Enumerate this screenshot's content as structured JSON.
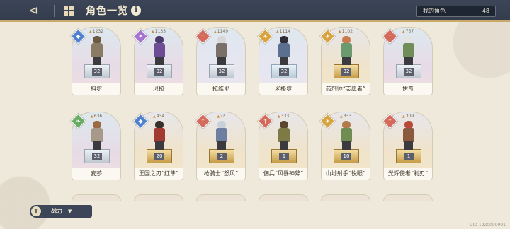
{
  "header": {
    "title": "角色一览",
    "owned_label": "我的角色",
    "owned_count": "48"
  },
  "characters": [
    {
      "name": "科尔",
      "power": "1232",
      "level": "32",
      "class": "blue",
      "class_icon": "shield-icon",
      "bg": "grad-pink",
      "pedestal": "silver",
      "hair": "#6b5a44",
      "outfit": "#8a7c64"
    },
    {
      "name": "贝拉",
      "power": "1135",
      "level": "32",
      "class": "purple",
      "class_icon": "star-icon",
      "bg": "grad-pink",
      "pedestal": "silver",
      "hair": "#4b3a6e",
      "outfit": "#6e4c96"
    },
    {
      "name": "拉维耶",
      "power": "1149",
      "level": "32",
      "class": "red",
      "class_icon": "sword-icon",
      "bg": "grad-blue",
      "pedestal": "silver",
      "hair": "#d6d6d6",
      "outfit": "#7b6f6a"
    },
    {
      "name": "米格尔",
      "power": "1114",
      "level": "32",
      "class": "gold",
      "class_icon": "sun-icon",
      "bg": "grad-blue",
      "pedestal": "lightblue",
      "hair": "#2f2c3a",
      "outfit": "#5b6f8f"
    },
    {
      "name": "药剂师“志愿者”",
      "power": "1102",
      "level": "32",
      "class": "gold",
      "class_icon": "sun-icon",
      "bg": "grad-gold",
      "pedestal": "gold",
      "hair": "#c97b4e",
      "outfit": "#6c9a6f"
    },
    {
      "name": "伊奇",
      "power": "757",
      "level": "32",
      "class": "red",
      "class_icon": "sword-icon",
      "bg": "grad-pink",
      "pedestal": "silver",
      "hair": "#e3e3e3",
      "outfit": "#6f8e5a"
    },
    {
      "name": "麦莎",
      "power": "636",
      "level": "32",
      "class": "green",
      "class_icon": "leaf-icon",
      "bg": "grad-pink",
      "pedestal": "silver",
      "hair": "#9b6a42",
      "outfit": "#a89a8a"
    },
    {
      "name": "王国之刃“红隼”",
      "power": "434",
      "level": "20",
      "class": "blue",
      "class_icon": "shield-icon",
      "bg": "grad-gold",
      "pedestal": "gold",
      "hair": "#3a2f2a",
      "outfit": "#a33a32"
    },
    {
      "name": "枪骑士“怒风”",
      "power": "??",
      "level": "2",
      "class": "red",
      "class_icon": "sword-icon",
      "bg": "grad-gold",
      "pedestal": "gold",
      "hair": "#c9d0dc",
      "outfit": "#6d7ea0"
    },
    {
      "name": "佣兵“风暴神斧”",
      "power": "333",
      "level": "1",
      "class": "red",
      "class_icon": "sword-icon",
      "bg": "grad-gold",
      "pedestal": "gold",
      "hair": "#5b4630",
      "outfit": "#7d7a45"
    },
    {
      "name": "山地射手“锐眼”",
      "power": "333",
      "level": "10",
      "class": "gold",
      "class_icon": "sun-icon",
      "bg": "grad-gold",
      "pedestal": "gold",
      "hair": "#b07a4a",
      "outfit": "#6f8d52"
    },
    {
      "name": "光辉使者“利刃”",
      "power": "309",
      "level": "1",
      "class": "red",
      "class_icon": "sword-icon",
      "bg": "grad-gold",
      "pedestal": "gold",
      "hair": "#b84a3a",
      "outfit": "#8a5a3e"
    }
  ],
  "footer": {
    "sort_label": "战力",
    "uid": "UID 1920000991"
  }
}
